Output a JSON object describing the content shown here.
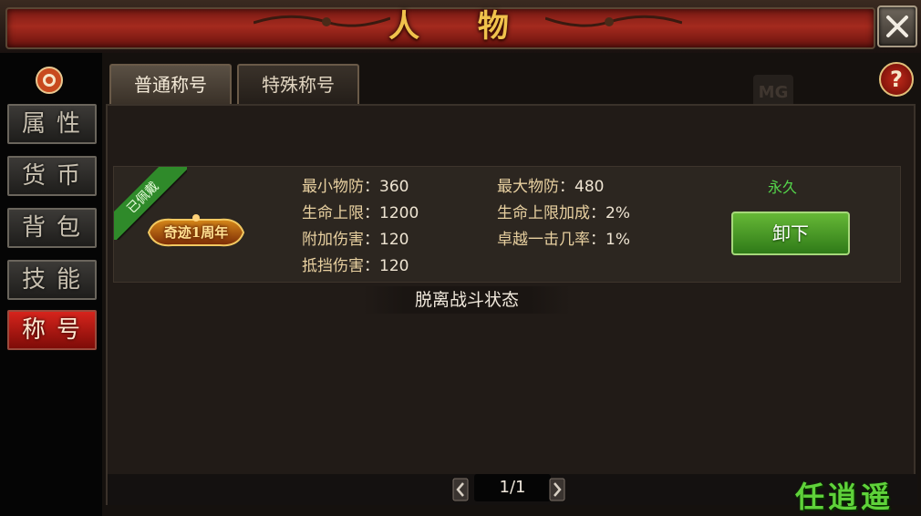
{
  "window": {
    "title": "人 物"
  },
  "nav": {
    "items": [
      {
        "label": "属性"
      },
      {
        "label": "货币"
      },
      {
        "label": "背包"
      },
      {
        "label": "技能"
      },
      {
        "label": "称号",
        "active": true
      }
    ]
  },
  "tabs": [
    {
      "label": "普通称号",
      "active": true
    },
    {
      "label": "特殊称号",
      "active": false
    }
  ],
  "help": {
    "label": "?"
  },
  "watermark_logo": {
    "label": "MG"
  },
  "title_card": {
    "status_ribbon": "已佩戴",
    "badge_text": "奇迹1周年",
    "stats": [
      {
        "key": "最小物防",
        "value": "360"
      },
      {
        "key": "最大物防",
        "value": "480"
      },
      {
        "key": "生命上限",
        "value": "1200"
      },
      {
        "key": "生命上限加成",
        "value": "2%"
      },
      {
        "key": "附加伤害",
        "value": "120"
      },
      {
        "key": "卓越一击几率",
        "value": "1%"
      },
      {
        "key": "抵挡伤害",
        "value": "120"
      }
    ],
    "separator": "：",
    "duration": "永久",
    "unequip_label": "卸下"
  },
  "combat_status": "脱离战斗状态",
  "pager": {
    "text": "1/1"
  },
  "corner_watermark": "任逍遥",
  "colors": {
    "title_gold": "#f0c24c",
    "active_tab_red": "#d6241c",
    "button_green": "#4f9e2a",
    "duration_green": "#54d44a"
  }
}
